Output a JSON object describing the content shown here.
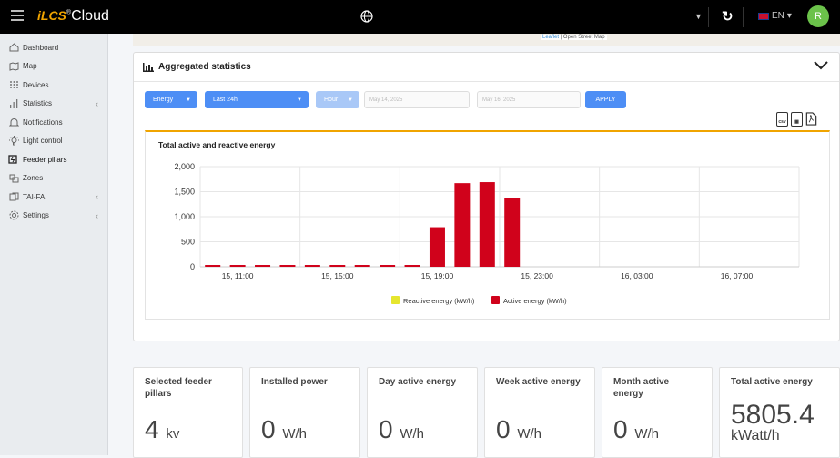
{
  "app": {
    "logo_prefix": "iLCS",
    "logo_suffix": "Cloud",
    "language": "EN",
    "avatar_initials": "R"
  },
  "sidebar": {
    "items": [
      {
        "label": "Dashboard",
        "icon": "home-icon"
      },
      {
        "label": "Map",
        "icon": "map-icon"
      },
      {
        "label": "Devices",
        "icon": "devices-icon"
      },
      {
        "label": "Statistics",
        "icon": "statistics-icon",
        "has_children": true
      },
      {
        "label": "Notifications",
        "icon": "bell-icon"
      },
      {
        "label": "Light control",
        "icon": "bulb-icon"
      },
      {
        "label": "Feeder pillars",
        "icon": "feeder-icon"
      },
      {
        "label": "Zones",
        "icon": "zones-icon"
      },
      {
        "label": "TAI-FAI",
        "icon": "tai-fai-icon",
        "has_children": true
      },
      {
        "label": "Settings",
        "icon": "gear-icon",
        "has_children": true
      }
    ]
  },
  "map": {
    "attribution_link": "Leaflet",
    "attribution_text": "| Open Street Map"
  },
  "stats_card": {
    "title": "Aggregated statistics",
    "filters": {
      "type": "Energy",
      "period": "Last 24h",
      "granularity": "Hour",
      "date_from": "May 14, 2025",
      "date_to": "May 16, 2025",
      "apply": "APPLY"
    },
    "export": [
      "csv",
      "xls",
      "pdf"
    ]
  },
  "chart_data": {
    "type": "bar",
    "title": "Total active and reactive energy",
    "x_tick_labels": [
      "15, 11:00",
      "15, 15:00",
      "15, 19:00",
      "15, 23:00",
      "16, 03:00",
      "16, 07:00"
    ],
    "categories": [
      "15, 10:00",
      "15, 11:00",
      "15, 12:00",
      "15, 13:00",
      "15, 14:00",
      "15, 15:00",
      "15, 16:00",
      "15, 17:00",
      "15, 18:00",
      "15, 19:00",
      "15, 20:00",
      "15, 21:00",
      "15, 22:00",
      "15, 23:00",
      "16, 00:00",
      "16, 01:00",
      "16, 02:00",
      "16, 03:00",
      "16, 04:00",
      "16, 05:00",
      "16, 06:00",
      "16, 07:00",
      "16, 08:00",
      "16, 09:00"
    ],
    "series": [
      {
        "name": "Reactive energy (kW/h)",
        "color": "#e6e62e",
        "values": [
          0,
          0,
          0,
          0,
          0,
          0,
          0,
          0,
          0,
          0,
          0,
          0,
          0,
          0,
          0,
          0,
          0,
          0,
          0,
          0,
          0,
          0,
          0,
          0
        ]
      },
      {
        "name": "Active energy (kW/h)",
        "color": "#d0021b",
        "values": [
          20,
          20,
          20,
          20,
          20,
          20,
          20,
          20,
          20,
          790,
          1670,
          1690,
          1370,
          0,
          0,
          0,
          0,
          0,
          0,
          0,
          0,
          0,
          0,
          0
        ]
      }
    ],
    "y_ticks": [
      "0",
      "500",
      "1,000",
      "1,500",
      "2,000"
    ],
    "ylim": [
      0,
      2000
    ],
    "grid": true,
    "legend": "bottom"
  },
  "stat_cards": [
    {
      "label": "Selected feeder pillars",
      "value": "4",
      "unit": "kv"
    },
    {
      "label": "Installed power",
      "value": "0",
      "unit": "W/h"
    },
    {
      "label": "Day active energy",
      "value": "0",
      "unit": "W/h"
    },
    {
      "label": "Week active energy",
      "value": "0",
      "unit": "W/h"
    },
    {
      "label": "Month active energy",
      "value": "0",
      "unit": "W/h"
    },
    {
      "label": "Total active energy",
      "value": "5805.4",
      "unit": "kWatt/h"
    }
  ]
}
